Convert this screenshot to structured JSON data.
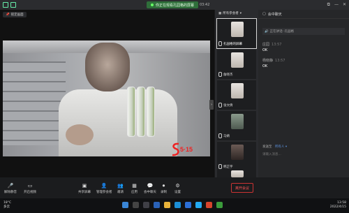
{
  "titlebar": {
    "share_banner": "你正在观看孔园格的屏幕",
    "timer": "03:42",
    "controls": [
      "⧉",
      "—",
      "✕"
    ]
  },
  "main": {
    "chip_label": "锁定画面",
    "watermark_text": "5·15"
  },
  "participants": {
    "header": "所有参会者",
    "tiles": [
      {
        "name": "孔园格的屏幕",
        "active": true
      },
      {
        "name": "詹晓杰",
        "active": false
      },
      {
        "name": "张文倩",
        "active": false
      },
      {
        "name": "马婧",
        "active": false
      },
      {
        "name": "韩芷宇",
        "active": false
      },
      {
        "name": "",
        "active": false
      }
    ]
  },
  "chat": {
    "header": "会中聊天",
    "system_message": "正在讲话: 孔园格",
    "messages": [
      {
        "who": "庄园",
        "time": "13:57",
        "text": "OK"
      },
      {
        "who": "杨晓静",
        "time": "13:57",
        "text": "OK"
      }
    ],
    "send_to_label": "发送至",
    "send_to_value": "所有人 ▾",
    "input_placeholder": "请输入消息..."
  },
  "toolbar": {
    "tools": [
      {
        "icon": "mic-icon",
        "glyph": "🎤",
        "label": "解除静音"
      },
      {
        "icon": "camera-icon",
        "glyph": "▭",
        "label": "开启视频"
      },
      {
        "icon": "screen-share-icon",
        "glyph": "▣",
        "label": "共享屏幕"
      },
      {
        "icon": "members-icon",
        "glyph": "👤",
        "label": "管理参会者"
      },
      {
        "icon": "invite-icon",
        "glyph": "👥",
        "label": "邀请"
      },
      {
        "icon": "apps-icon",
        "glyph": "▦",
        "label": "应用"
      },
      {
        "icon": "chat-icon",
        "glyph": "💬",
        "label": "会中聊天"
      },
      {
        "icon": "record-icon",
        "glyph": "⏺",
        "label": "录制"
      },
      {
        "icon": "settings-icon",
        "glyph": "⚙",
        "label": "设置"
      }
    ],
    "leave_label": "离开会议"
  },
  "taskbar": {
    "weather_temp": "18°C",
    "weather_desc": "多云",
    "time": "13:58",
    "date": "2022/4/15"
  },
  "colors": {
    "accent_green": "#2f6f3a",
    "leave_red": "#c33",
    "link_blue": "#5b8fd9"
  }
}
